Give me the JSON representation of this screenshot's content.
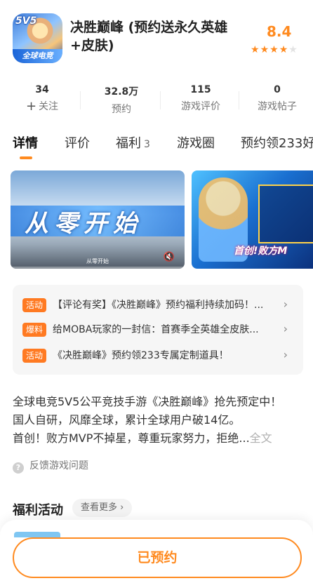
{
  "app": {
    "icon_badge": "5V5",
    "icon_tag": "全球电竞",
    "title": "决胜巅峰 (预约送永久英雄+皮肤)",
    "rating": "8.4",
    "rating_stars": 4,
    "accent_color": "#ff8a1f"
  },
  "stats": [
    {
      "num": "34",
      "label": "关注",
      "icon": "plus-icon"
    },
    {
      "num": "32.8万",
      "label": "预约"
    },
    {
      "num": "115",
      "label": "游戏评价"
    },
    {
      "num": "0",
      "label": "游戏帖子"
    }
  ],
  "tabs": [
    {
      "label": "详情"
    },
    {
      "label": "评价"
    },
    {
      "label": "福利",
      "count": "3"
    },
    {
      "label": "游戏圈"
    },
    {
      "label": "预约领233好"
    }
  ],
  "media": {
    "video_title": "从零开始",
    "video_subtitle": "从零开始",
    "image_banner": "首创!败方M"
  },
  "news": [
    {
      "tag": "活动",
      "text": "【评论有奖】《决胜巅峰》预约福利持续加码！..."
    },
    {
      "tag": "爆料",
      "text": "给MOBA玩家的一封信：首赛季全英雄全皮肤..."
    },
    {
      "tag": "活动",
      "text": "《决胜巅峰》预约领233专属定制道具！"
    }
  ],
  "description": {
    "line1": "全球电竞5V5公平竞技手游《决胜巅峰》抢先预定中！",
    "line2": "国人自研，风靡全球，累计全球用户破14亿。",
    "line3": "首创！败方MVP不掉星，尊重玩家努力，拒绝...",
    "more": "全文"
  },
  "feedback": "反馈游戏问题",
  "section": {
    "title": "福利活动",
    "see_more": "查看更多 ›"
  },
  "reserve_button": "已预约"
}
